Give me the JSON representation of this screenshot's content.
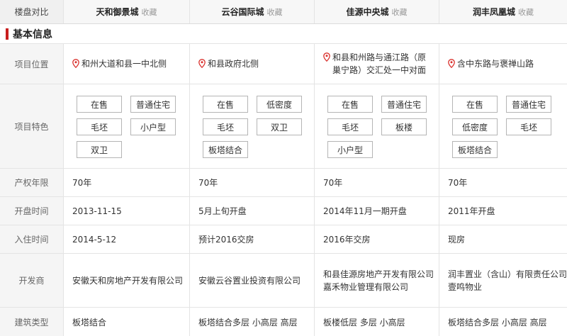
{
  "header": {
    "label": "楼盘对比",
    "fav_label": "收藏",
    "buildings": [
      "天和御景城",
      "云谷国际城",
      "佳源中央城",
      "润丰凤凰城"
    ]
  },
  "section": {
    "title": "基本信息"
  },
  "rows": {
    "location": {
      "label": "项目位置",
      "values": [
        "和州大道和县一中北侧",
        "和县政府北侧",
        "和县和州路与通江路（原巢宁路）交汇处一中对面",
        "含中东路与褒禅山路"
      ]
    },
    "features": {
      "label": "项目特色",
      "values": [
        [
          "在售",
          "普通住宅",
          "毛坯",
          "小户型",
          "双卫"
        ],
        [
          "在售",
          "低密度",
          "毛坯",
          "双卫",
          "板塔结合"
        ],
        [
          "在售",
          "普通住宅",
          "毛坯",
          "板楼",
          "小户型"
        ],
        [
          "在售",
          "普通住宅",
          "低密度",
          "毛坯",
          "板塔结合"
        ]
      ]
    },
    "property_years": {
      "label": "产权年限",
      "values": [
        "70年",
        "70年",
        "70年",
        "70年"
      ]
    },
    "opening_time": {
      "label": "开盘时间",
      "values": [
        "2013-11-15",
        "5月上旬开盘",
        "2014年11月一期开盘",
        "2011年开盘"
      ]
    },
    "movein_time": {
      "label": "入住时间",
      "values": [
        "2014-5-12",
        "预计2016交房",
        "2016年交房",
        "现房"
      ]
    },
    "developer": {
      "label": "开发商",
      "values": [
        [
          "安徽天和房地产开发有限公司"
        ],
        [
          "安徽云谷置业投资有限公司"
        ],
        [
          "和县佳源房地产开发有限公司",
          "嘉禾物业管理有限公司"
        ],
        [
          "润丰置业（含山）有限责任公司",
          "壹鸣物业"
        ]
      ]
    },
    "building_type": {
      "label": "建筑类型",
      "values": [
        "板塔结合",
        "板塔结合多层 小高层 高层",
        "板楼低层 多层 小高层",
        "板塔结合多层 小高层 高层"
      ]
    }
  },
  "colors": {
    "accent": "#c81e1e",
    "pin": "#d9302c",
    "border": "#e4e4e4"
  }
}
